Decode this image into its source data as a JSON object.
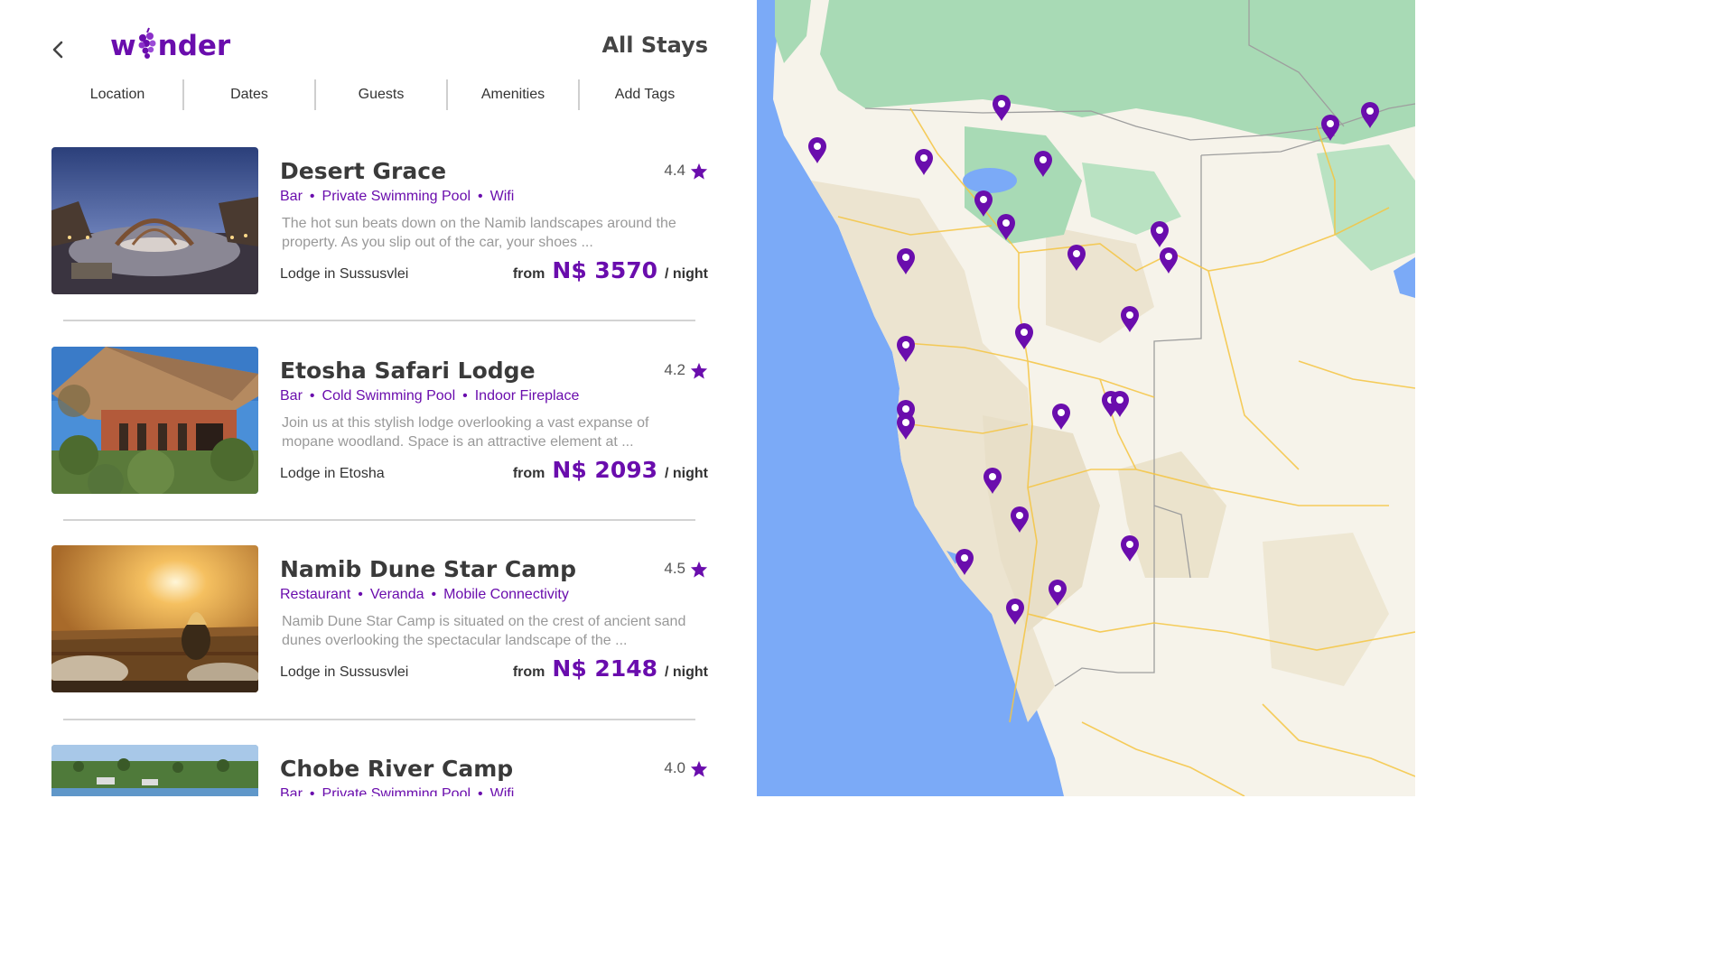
{
  "header": {
    "back_label": "<",
    "logo_text_left": "w",
    "logo_text_right": "nder",
    "title": "All Stays"
  },
  "filters": [
    "Location",
    "Dates",
    "Guests",
    "Amenities",
    "Add Tags"
  ],
  "listings": [
    {
      "name": "Desert Grace",
      "rating": "4.4",
      "amenities": [
        "Bar",
        "Private Swimming Pool",
        "Wifi"
      ],
      "description": "The hot sun beats down on the Namib landscapes around the property. As you slip out of the car, your shoes ...",
      "location": "Lodge in Sussusvlei",
      "price_from": "from",
      "price": "N$ 3570",
      "per": "/ night"
    },
    {
      "name": "Etosha Safari Lodge",
      "rating": "4.2",
      "amenities": [
        "Bar",
        "Cold Swimming Pool",
        "Indoor Fireplace"
      ],
      "description": "Join us at this stylish lodge overlooking a vast expanse of mopane woodland. Space is an attractive element at ...",
      "location": "Lodge in Etosha",
      "price_from": "from",
      "price": "N$ 2093",
      "per": "/ night"
    },
    {
      "name": "Namib Dune Star Camp",
      "rating": "4.5",
      "amenities": [
        "Restaurant",
        "Veranda",
        "Mobile Connectivity"
      ],
      "description": "Namib Dune Star Camp is situated on the crest of ancient sand dunes overlooking the spectacular landscape of the ...",
      "location": "Lodge in Sussusvlei",
      "price_from": "from",
      "price": "N$ 2148",
      "per": "/ night"
    },
    {
      "name": "Chobe River Camp",
      "rating": "4.0",
      "amenities": [
        "Bar",
        "Private Swimming Pool",
        "Wifi"
      ],
      "description": "",
      "location": "",
      "price_from": "",
      "price": "",
      "per": ""
    }
  ],
  "colors": {
    "accent": "#6a0dad",
    "ocean": "#7baaf7",
    "land": "#f6f3ea",
    "forest": "#a8dab5",
    "road": "#f5c542"
  },
  "icons": {
    "back": "chevron-left-icon",
    "rating": "star-icon",
    "map_marker": "map-pin-icon"
  }
}
